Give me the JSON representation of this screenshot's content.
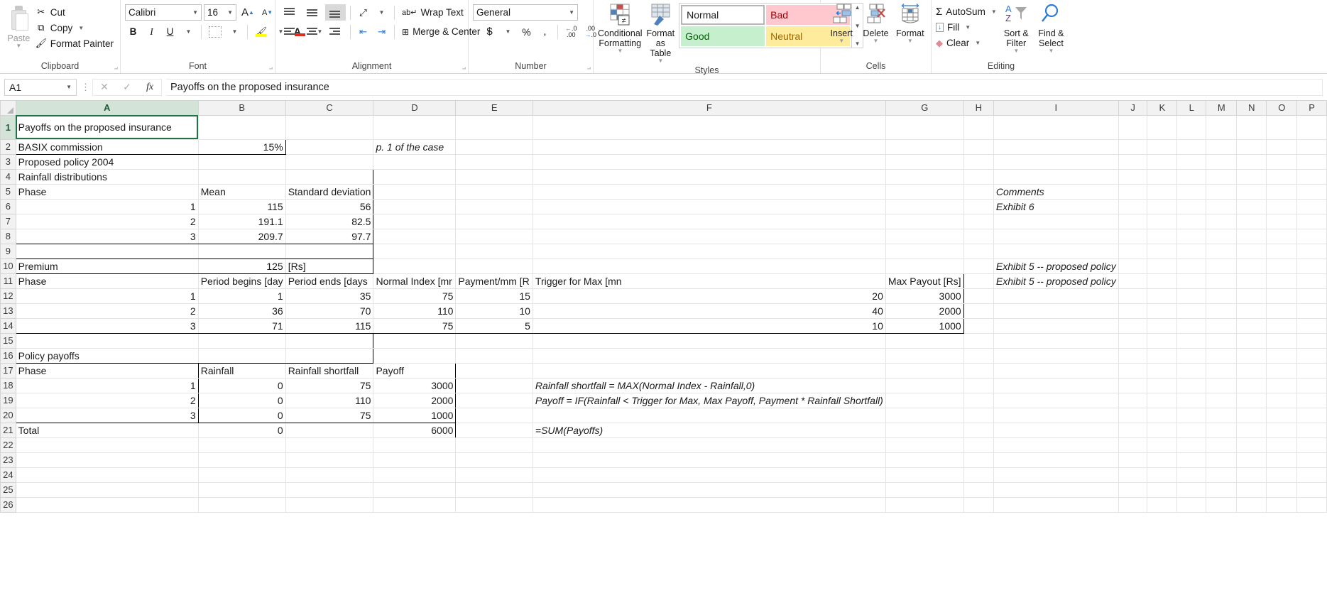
{
  "ribbon": {
    "clipboard": {
      "label": "Clipboard",
      "paste": "Paste",
      "items": [
        {
          "label": "Cut",
          "icon": "scissors-icon"
        },
        {
          "label": "Copy",
          "icon": "copy-icon"
        },
        {
          "label": "Format Painter",
          "icon": "paintbrush-icon"
        }
      ]
    },
    "font": {
      "label": "Font",
      "font_name": "Calibri",
      "font_size": "16",
      "grow_font": "A",
      "shrink_font": "A",
      "bold": "B",
      "italic": "I",
      "underline": "U",
      "borders": "borders-icon",
      "fill_color": "fill-color-icon",
      "font_color": "font-color-icon"
    },
    "alignment": {
      "label": "Alignment",
      "wrap_text": "Wrap Text",
      "merge_center": "Merge & Center",
      "orientation": "orientation-icon",
      "top_align": "top-align-icon",
      "middle_align": "middle-align-icon",
      "bottom_align": "bottom-align-icon",
      "align_left": "align-left-icon",
      "align_center": "align-center-icon",
      "align_right": "align-right-icon",
      "decrease_indent": "decrease-indent-icon",
      "increase_indent": "increase-indent-icon"
    },
    "number": {
      "label": "Number",
      "format": "General",
      "accounting": "$",
      "percent": "%",
      "comma": ",",
      "increase_decimal": "increase-decimal-icon",
      "decrease_decimal": "decrease-decimal-icon"
    },
    "styles": {
      "label": "Styles",
      "conditional_formatting": "Conditional Formatting",
      "format_as_table": "Format as Table",
      "cell_styles": [
        {
          "name": "Normal",
          "bg": "#ffffff",
          "fg": "#1a1a1a"
        },
        {
          "name": "Bad",
          "bg": "#ffc7ce",
          "fg": "#9c0006"
        },
        {
          "name": "Good",
          "bg": "#c6efce",
          "fg": "#006100"
        },
        {
          "name": "Neutral",
          "bg": "#ffeb9c",
          "fg": "#9c6500"
        }
      ]
    },
    "cells": {
      "label": "Cells",
      "insert": "Insert",
      "delete": "Delete",
      "format": "Format"
    },
    "editing": {
      "label": "Editing",
      "autosum": "AutoSum",
      "fill": "Fill",
      "clear": "Clear",
      "sort_filter": "Sort & Filter",
      "find_select": "Find & Select"
    }
  },
  "formula_bar": {
    "name_box": "A1",
    "cancel": "✕",
    "enter": "✓",
    "fx": "fx",
    "value": "Payoffs on the proposed insurance"
  },
  "sheet": {
    "columns": [
      "A",
      "B",
      "C",
      "D",
      "E",
      "F",
      "G",
      "H",
      "I",
      "J",
      "K",
      "L",
      "M",
      "N",
      "O",
      "P"
    ],
    "active_cell": "A1",
    "rows": [
      {
        "n": "1",
        "cells": {
          "A": "Payoffs on the proposed insurance"
        }
      },
      {
        "n": "2",
        "cells": {
          "A": "BASIX commission",
          "B": "15%",
          "D": "p. 1 of the case"
        }
      },
      {
        "n": "3",
        "cells": {
          "A": "Proposed policy 2004"
        }
      },
      {
        "n": "4",
        "cells": {
          "A": "Rainfall distributions"
        }
      },
      {
        "n": "5",
        "cells": {
          "A": "Phase",
          "B": "Mean",
          "C": "Standard deviation",
          "I": "Comments"
        }
      },
      {
        "n": "6",
        "cells": {
          "A": "1",
          "B": "115",
          "C": "56",
          "I": "Exhibit 6"
        }
      },
      {
        "n": "7",
        "cells": {
          "A": "2",
          "B": "191.1",
          "C": "82.5"
        }
      },
      {
        "n": "8",
        "cells": {
          "A": "3",
          "B": "209.7",
          "C": "97.7"
        }
      },
      {
        "n": "9",
        "cells": {}
      },
      {
        "n": "10",
        "cells": {
          "A": "Premium",
          "B": "125",
          "C": "[Rs]",
          "I": "Exhibit 5 -- proposed policy"
        }
      },
      {
        "n": "11",
        "cells": {
          "A": "Phase",
          "B": "Period begins [day",
          "C": "Period ends [days",
          "D": "Normal Index [mr",
          "E": "Payment/mm [R",
          "F": "Trigger for Max [mn",
          "G": "Max Payout [Rs]",
          "I": "Exhibit 5 -- proposed policy"
        }
      },
      {
        "n": "12",
        "cells": {
          "A": "1",
          "B": "1",
          "C": "35",
          "D": "75",
          "E": "15",
          "F": "20",
          "G": "3000"
        }
      },
      {
        "n": "13",
        "cells": {
          "A": "2",
          "B": "36",
          "C": "70",
          "D": "110",
          "E": "10",
          "F": "40",
          "G": "2000"
        }
      },
      {
        "n": "14",
        "cells": {
          "A": "3",
          "B": "71",
          "C": "115",
          "D": "75",
          "E": "5",
          "F": "10",
          "G": "1000"
        }
      },
      {
        "n": "15",
        "cells": {}
      },
      {
        "n": "16",
        "cells": {
          "A": "Policy payoffs"
        }
      },
      {
        "n": "17",
        "cells": {
          "A": "Phase",
          "B": "Rainfall",
          "C": "Rainfall shortfall",
          "D": "Payoff"
        }
      },
      {
        "n": "18",
        "cells": {
          "A": "1",
          "B": "0",
          "C": "75",
          "D": "3000",
          "F": "Rainfall shortfall = MAX(Normal Index - Rainfall,0)"
        }
      },
      {
        "n": "19",
        "cells": {
          "A": "2",
          "B": "0",
          "C": "110",
          "D": "2000",
          "F": "Payoff = IF(Rainfall < Trigger for Max, Max Payoff, Payment * Rainfall Shortfall)"
        }
      },
      {
        "n": "20",
        "cells": {
          "A": "3",
          "B": "0",
          "C": "75",
          "D": "1000"
        }
      },
      {
        "n": "21",
        "cells": {
          "A": "Total",
          "B": "0",
          "D": "6000",
          "F": "=SUM(Payoffs)"
        }
      },
      {
        "n": "22",
        "cells": {}
      },
      {
        "n": "23",
        "cells": {}
      },
      {
        "n": "24",
        "cells": {}
      },
      {
        "n": "25",
        "cells": {}
      },
      {
        "n": "26",
        "cells": {}
      }
    ]
  }
}
